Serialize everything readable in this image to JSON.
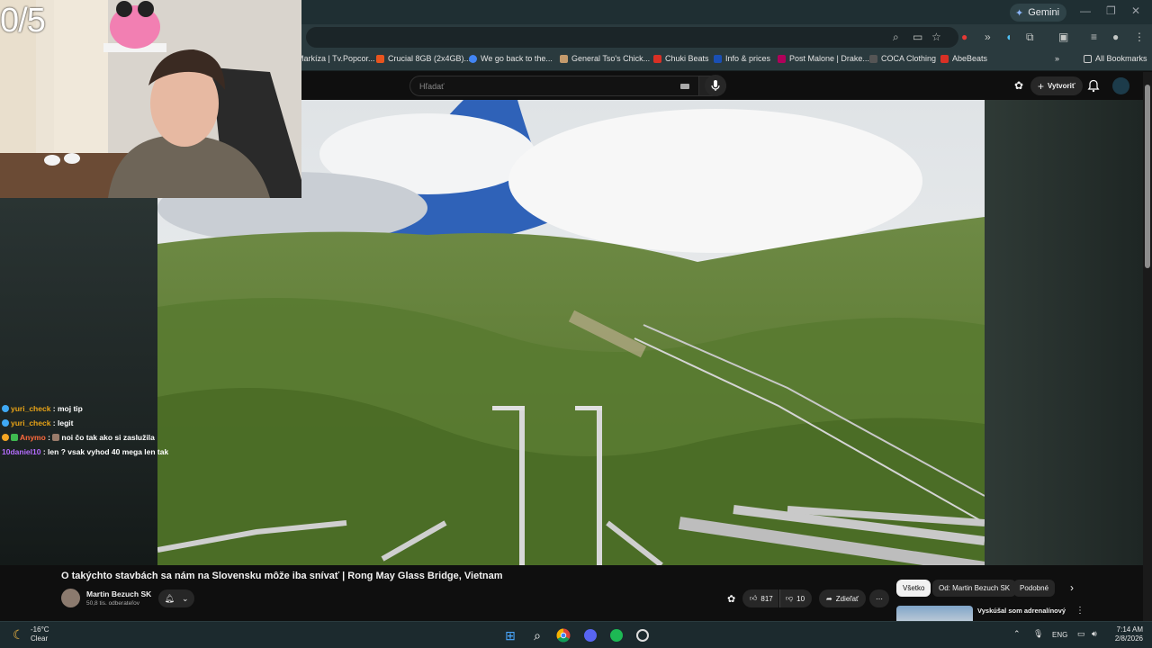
{
  "browser": {
    "gemini_label": "Gemini",
    "bookmarks": [
      {
        "label": "Markíza | Tv.Popcor...",
        "color": "#3a7bd5"
      },
      {
        "label": "Crucial 8GB (2x4GB)...",
        "color": "#e8541e"
      },
      {
        "label": "We go back to the...",
        "color": "#4285f4"
      },
      {
        "label": "General Tso's Chick...",
        "color": "#c49a6c"
      },
      {
        "label": "Chuki Beats",
        "color": "#d93025"
      },
      {
        "label": "Info & prices",
        "color": "#1a4fb4"
      },
      {
        "label": "Post Malone | Drake...",
        "color": "#b0005a"
      },
      {
        "label": "COCA Clothing",
        "color": "#333333"
      },
      {
        "label": "AbeBeats",
        "color": "#d93025"
      }
    ],
    "all_bookmarks": "All Bookmarks"
  },
  "youtube": {
    "search_placeholder": "Hľadať",
    "create_label": "Vytvoriť",
    "video_title": "O takýchto stavbách sa nám na Slovensku môže iba snívať | Rong May Glass Bridge, Vietnam",
    "channel_name": "Martin Bezuch SK",
    "subscribers": "50,8 tis. odberateľov",
    "likes": "817",
    "dislikes": "10",
    "share_label": "Zdieľať",
    "chips": [
      "Všetko",
      "Od: Martin Bezuch SK",
      "Podobné"
    ],
    "recommended_title": "Vyskúšal som adrenalínový"
  },
  "stream": {
    "counter": "0/5",
    "chat": [
      {
        "user": "yuri_check",
        "color": "#e8a317",
        "message": "moj tip"
      },
      {
        "user": "yuri_check",
        "color": "#e8a317",
        "message": "legit"
      },
      {
        "user": "Anymo",
        "color": "#ff6a3d",
        "message": "noi čo tak ako si zaslužila"
      },
      {
        "user": "10daniel10",
        "color": "#b46cff",
        "message": "len ? vsak vyhod 40 mega len tak"
      }
    ]
  },
  "taskbar": {
    "temperature": "-16°C",
    "weather": "Clear",
    "language": "ENG",
    "time": "7:14 AM",
    "date": "2/8/2026"
  }
}
